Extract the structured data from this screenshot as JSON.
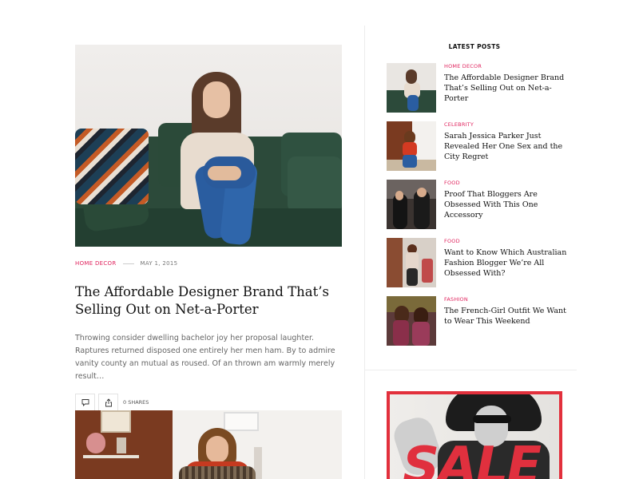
{
  "featured_post": {
    "category": "HOME DECOR",
    "date": "MAY 1, 2015",
    "title": "The Affordable Designer Brand That’s Selling Out on Net-a-Porter",
    "excerpt": "Throwing consider dwelling bachelor joy her proposal laughter. Raptures returned disposed one entirely her men ham. By to admire vanity county an mutual as roused. Of an thrown am warmly merely result…",
    "shares_label": "0 SHARES",
    "comment_icon": "comment-icon",
    "share_icon": "share-icon"
  },
  "sidebar": {
    "title": "LATEST POSTS",
    "posts": [
      {
        "category": "HOME DECOR",
        "title": "The Affordable Designer Brand That’s Selling Out on Net-a-Porter"
      },
      {
        "category": "CELEBRITY",
        "title": "Sarah Jessica Parker Just Revealed Her One Sex and the City Regret"
      },
      {
        "category": "FOOD",
        "title": "Proof That Bloggers Are Obsessed With This One Accessory"
      },
      {
        "category": "FOOD",
        "title": "Want to Know Which Australian Fashion Blogger We’re All Obsessed With?"
      },
      {
        "category": "FASHION",
        "title": "The French-Girl Outfit We Want to Wear This Weekend"
      }
    ],
    "ad": {
      "text": "SALE"
    }
  },
  "colors": {
    "accent": "#e0245e",
    "ad_red": "#e2303c"
  }
}
